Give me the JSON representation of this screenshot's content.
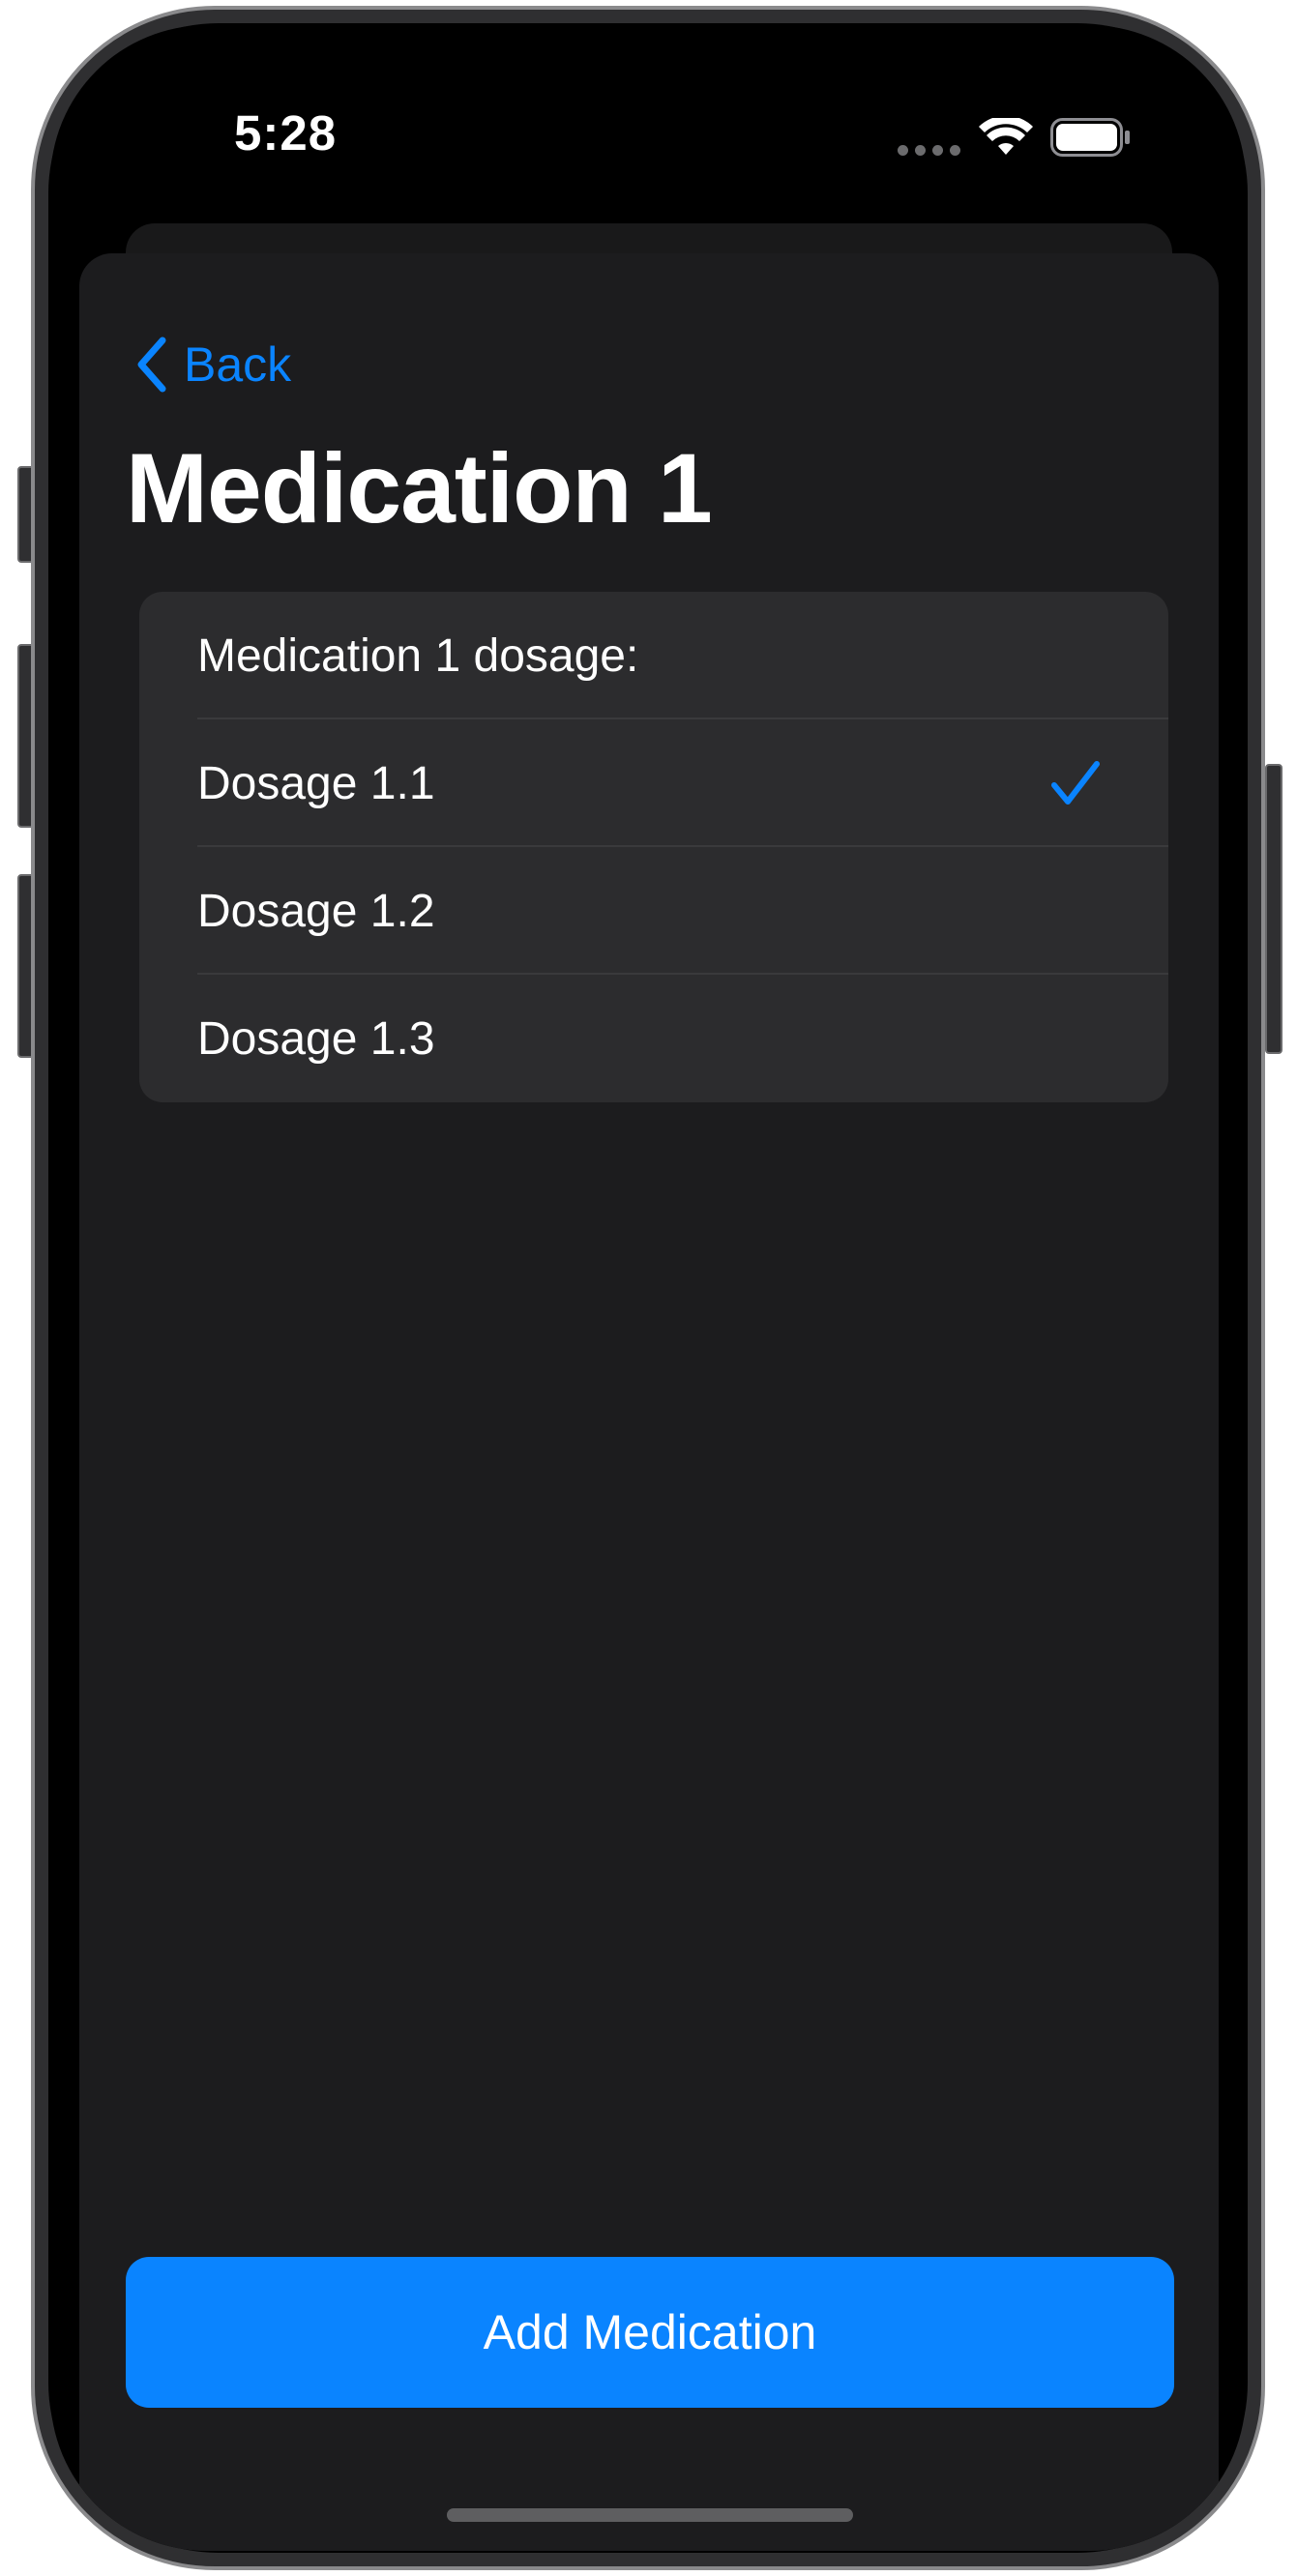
{
  "status_bar": {
    "time": "5:28"
  },
  "navigation": {
    "back_label": "Back"
  },
  "page": {
    "title": "Medication 1"
  },
  "dosage_list": {
    "header": "Medication 1 dosage:",
    "options": [
      {
        "label": "Dosage 1.1",
        "selected": true
      },
      {
        "label": "Dosage 1.2",
        "selected": false
      },
      {
        "label": "Dosage 1.3",
        "selected": false
      }
    ]
  },
  "actions": {
    "add_label": "Add Medication"
  },
  "colors": {
    "accent": "#0a84ff",
    "background": "#1c1c1e",
    "card": "#2c2c2e",
    "text": "#ffffff"
  },
  "icons": {
    "back": "chevron-left-icon",
    "selected": "checkmark-icon",
    "wifi": "wifi-icon",
    "battery": "battery-icon",
    "signal": "cellular-signal-icon"
  }
}
